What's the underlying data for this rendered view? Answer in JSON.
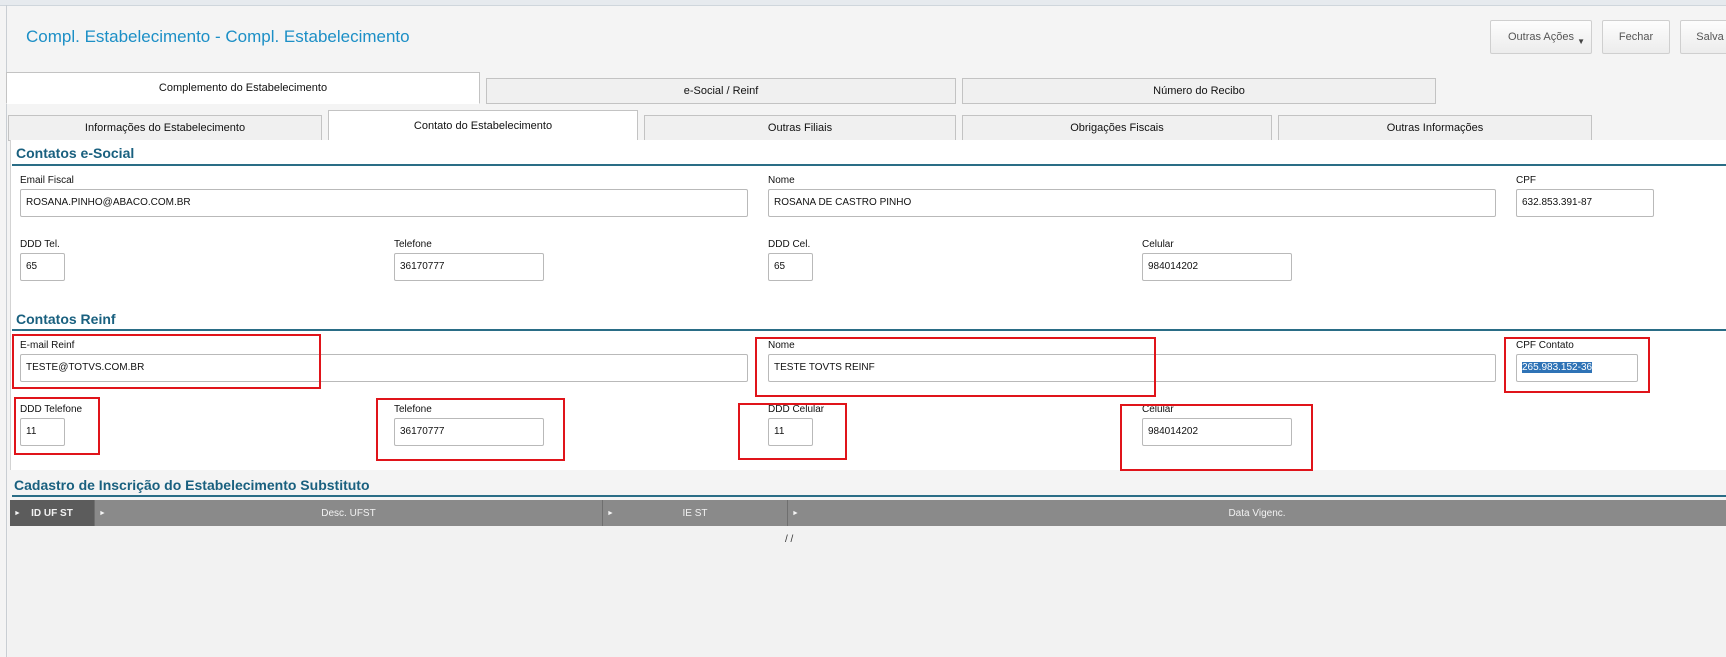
{
  "window": {
    "title": "Compl. Estabelecimento - Compl. Estabelecimento"
  },
  "toolbar": {
    "more_actions": "Outras Ações",
    "close": "Fechar",
    "save": "Salva"
  },
  "tabs_top": [
    "Complemento do Estabelecimento",
    "e-Social / Reinf",
    "Número do Recibo"
  ],
  "tabs_sub": [
    "Informações do Estabelecimento",
    "Contato do Estabelecimento",
    "Outras Filiais",
    "Obrigações Fiscais",
    "Outras Informações"
  ],
  "esocial": {
    "title": "Contatos e-Social",
    "email_label": "Email Fiscal",
    "email": "ROSANA.PINHO@ABACO.COM.BR",
    "name_label": "Nome",
    "name": "ROSANA DE CASTRO PINHO",
    "cpf_label": "CPF",
    "cpf": "632.853.391-87",
    "ddd_tel_label": "DDD Tel.",
    "ddd_tel": "65",
    "tel_label": "Telefone",
    "tel": "36170777",
    "ddd_cel_label": "DDD Cel.",
    "ddd_cel": "65",
    "cel_label": "Celular",
    "cel": "984014202"
  },
  "reinf": {
    "title": "Contatos Reinf",
    "email_label": "E-mail Reinf",
    "email": "TESTE@TOTVS.COM.BR",
    "name_label": "Nome",
    "name": "TESTE TOVTS REINF",
    "cpf_label": "CPF Contato",
    "cpf": "265.983.152-36",
    "ddd_tel_label": "DDD Telefone",
    "ddd_tel": "11",
    "tel_label": "Telefone",
    "tel": "36170777",
    "ddd_cel_label": "DDD Celular",
    "ddd_cel": "11",
    "cel_label": "Celular",
    "cel": "984014202"
  },
  "substitute": {
    "title": "Cadastro de Inscrição do Estabelecimento Substituto",
    "columns": [
      "ID UF ST",
      "Desc. UFST",
      "IE ST",
      "Data Vigenc."
    ],
    "empty_row_date": "/ /"
  },
  "colors": {
    "title": "#1c8fc6",
    "section": "#19607f",
    "highlight": "#e0141a",
    "selection": "#2f73b6"
  }
}
